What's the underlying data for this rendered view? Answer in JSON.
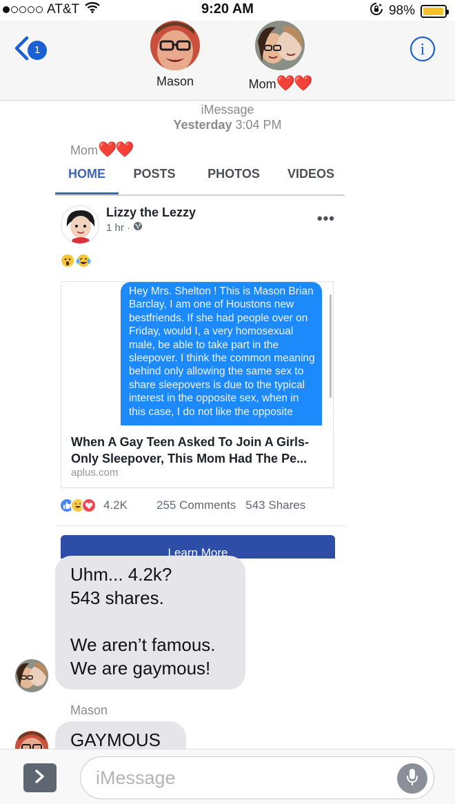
{
  "status_bar": {
    "carrier": "AT&T",
    "time": "9:20 AM",
    "battery": "98%",
    "battery_level": 0.98,
    "signal_bars": 1,
    "icons": [
      "signal-dots-icon",
      "wifi-icon",
      "rotation-lock-icon",
      "battery-icon"
    ]
  },
  "header": {
    "back_badge": "1",
    "contacts": [
      {
        "name": "Mason",
        "avatar": "avatar-mason"
      },
      {
        "name": "Mom",
        "hearts": "❤️❤️",
        "avatar": "avatar-mom"
      }
    ],
    "icons": [
      "back-chevron-icon",
      "info-icon"
    ]
  },
  "timestamp": {
    "service": "iMessage",
    "day": "Yesterday",
    "time": "3:04 PM"
  },
  "shared_post": {
    "sender": "Mom",
    "sender_hearts": "❤️❤️",
    "tabs": [
      "HOME",
      "POSTS",
      "PHOTOS",
      "VIDEOS"
    ],
    "active_tab": "HOME",
    "author": "Lizzy the Lezzy",
    "time": "1 hr ·",
    "more": "•••",
    "emoji": [
      "😮",
      "😂"
    ],
    "link_image_text": "Hey Mrs. Shelton ! This is Mason Brian Barclay, I am one of Houstons new bestfriends. If she had people over on Friday, would I, a very homosexual male, be able to take part in the sleepover. I think the common meaning behind only allowing the same sex to share sleepovers is due to the typical interest in the opposite sex, when in this case, I do not like the opposite",
    "link_title": "When A Gay Teen Asked To Join A Girls-Only Sleepover, This Mom Had The Pe...",
    "link_domain": "aplus.com",
    "reaction_count": "4.2K",
    "comments": "255 Comments",
    "shares": "543 Shares",
    "cta": "Learn More",
    "accent_color": "#4267b2"
  },
  "messages": [
    {
      "sender": "Mom",
      "lines_1": [
        "Uhm... 4.2k?",
        "543 shares."
      ],
      "lines_2": [
        "We aren’t famous.",
        "We are gaymous!"
      ]
    },
    {
      "sender": "Mason",
      "text": "GAYMOUS"
    }
  ],
  "input": {
    "placeholder": "iMessage"
  },
  "icons": [
    "expand-arrow-icon",
    "microphone-icon"
  ]
}
